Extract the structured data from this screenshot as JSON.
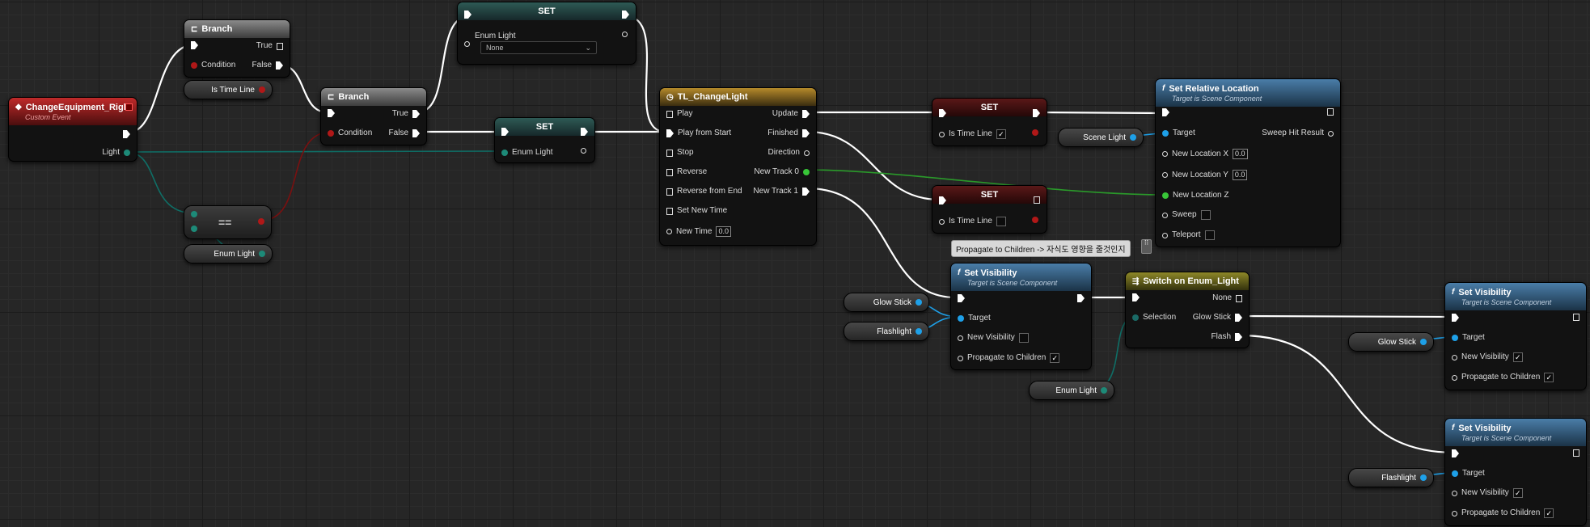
{
  "nodes": {
    "custom_event": {
      "title": "ChangeEquipment_Right",
      "subtitle": "Custom Event",
      "pin_light": "Light"
    },
    "branch1": {
      "title": "Branch",
      "condition": "Condition",
      "true": "True",
      "false": "False"
    },
    "branch2": {
      "title": "Branch",
      "condition": "Condition",
      "true": "True",
      "false": "False"
    },
    "is_time_line_getter": "Is Time Line",
    "equals": {
      "symbol": "=="
    },
    "enum_light_getter": "Enum Light",
    "set_top": {
      "title": "SET",
      "pin_label": "Enum Light",
      "dropdown": "None"
    },
    "set_mid": {
      "title": "SET",
      "pin_label": "Enum Light"
    },
    "timeline": {
      "title": "TL_ChangeLight",
      "inputs": [
        "Play",
        "Play from Start",
        "Stop",
        "Reverse",
        "Reverse from End",
        "Set New Time",
        "New Time"
      ],
      "new_time_value": "0.0",
      "outputs": [
        "Update",
        "Finished",
        "Direction",
        "New Track 0",
        "New Track 1"
      ]
    },
    "set_timeline_true": {
      "title": "SET",
      "pin_label": "Is Time Line",
      "checked": "✓"
    },
    "set_timeline_false": {
      "title": "SET",
      "pin_label": "Is Time Line"
    },
    "set_relative_location": {
      "title": "Set Relative Location",
      "subtitle": "Target is Scene Component",
      "target": "Target",
      "sweep_hit": "Sweep Hit Result",
      "new_x": "New Location X",
      "new_y": "New Location Y",
      "new_z": "New Location Z",
      "x_val": "0.0",
      "y_val": "0.0",
      "sweep": "Sweep",
      "teleport": "Teleport"
    },
    "scene_light": "Scene Light",
    "comment": "Propagate to Children -> 자식도 영향을 줄것인지",
    "set_visibility_main": {
      "title": "Set Visibility",
      "subtitle": "Target is Scene Component",
      "target": "Target",
      "new_visibility": "New Visibility",
      "propagate": "Propagate to Children",
      "propagate_checked": "✓"
    },
    "glow_stick_1": "Glow Stick",
    "flashlight_1": "Flashlight",
    "switch": {
      "title": "Switch on Enum_Light",
      "selection": "Selection",
      "none": "None",
      "glow": "Glow Stick",
      "flash": "Flash"
    },
    "enum_light_2": "Enum Light",
    "set_visibility_glow": {
      "title": "Set Visibility",
      "subtitle": "Target is Scene Component",
      "target": "Target",
      "new_visibility": "New Visibility",
      "nv_checked": "✓",
      "propagate": "Propagate to Children",
      "propagate_checked": "✓"
    },
    "glow_stick_2": "Glow Stick",
    "set_visibility_flash": {
      "title": "Set Visibility",
      "subtitle": "Target is Scene Component",
      "target": "Target",
      "new_visibility": "New Visibility",
      "nv_checked": "✓",
      "propagate": "Propagate to Children",
      "propagate_checked": "✓"
    },
    "flashlight_2": "Flashlight"
  },
  "colors": {
    "exec_wire": "#ffffff",
    "enum_wire": "#0f6e66",
    "bool_wire": "#8a1010",
    "object_wire": "#1ea0e8",
    "float_wire": "#3ac43a",
    "background": "#262626"
  }
}
